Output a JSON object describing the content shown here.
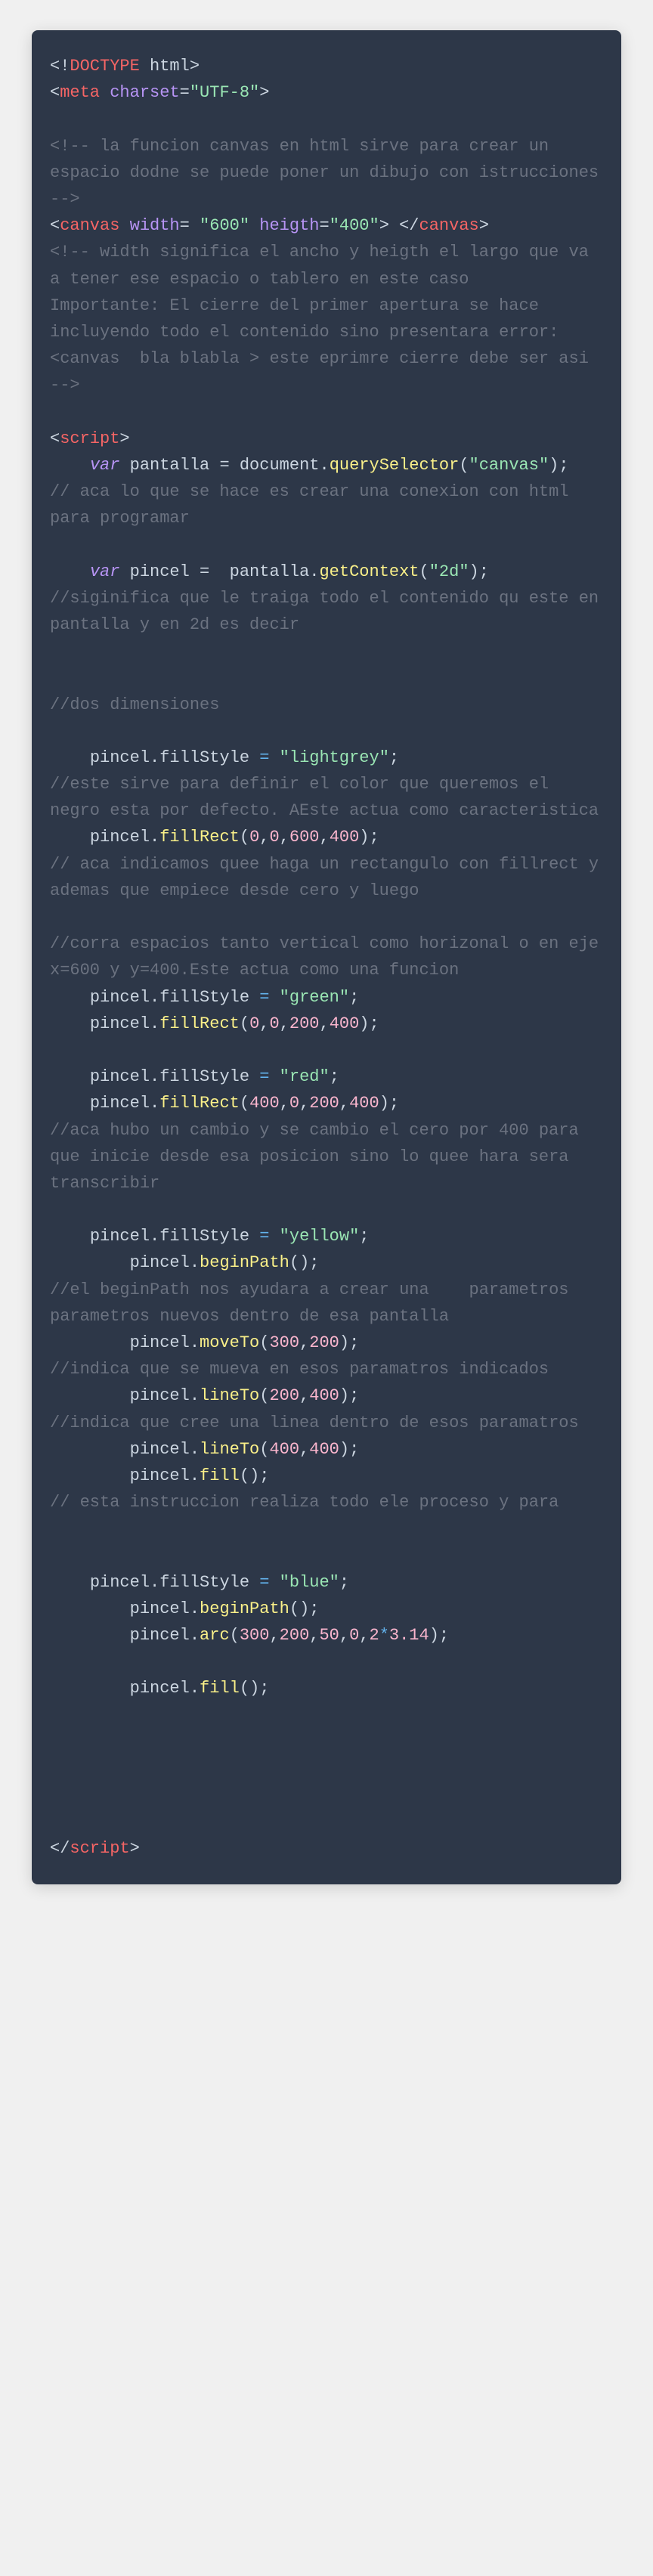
{
  "code": {
    "doctype_open": "<!",
    "doctype_word": "DOCTYPE",
    "doctype_html": " html",
    "doctype_close": ">",
    "meta_open": "<",
    "meta_tag": "meta",
    "meta_attr": "charset",
    "meta_eq": "=",
    "meta_val": "\"UTF-8\"",
    "meta_close": ">",
    "comment1": "<!-- la funcion canvas en html sirve para crear un espacio dodne se puede poner un dibujo con istrucciones  -->",
    "canvas_open": "<",
    "canvas_tag": "canvas",
    "canvas_attr_w": "width",
    "canvas_val_w": "\"600\"",
    "canvas_attr_h": "heigth",
    "canvas_val_h": "\"400\"",
    "canvas_mid": "> </",
    "canvas_close_tag": "canvas",
    "canvas_end": ">",
    "comment2": "<!-- width significa el ancho y heigth el largo que va a tener ese espacio o tablero en este caso\nImportante: El cierre del primer apertura se hace incluyendo todo el contenido sino presentara error:\n<canvas  bla blabla > este eprimre cierre debe ser asi  -->",
    "script_open": "<",
    "script_tag": "script",
    "script_close": ">",
    "kw_var": "var",
    "var_pantalla": "pantalla",
    "eq": " = ",
    "doc": "document",
    "dot": ".",
    "querySelector": "querySelector",
    "lp": "(",
    "rp": ")",
    "semi": ";",
    "str_canvas": "\"canvas\"",
    "comment3": "// aca lo que se hace es crear una conexion con html para programar",
    "var_pincel": "pincel",
    "getContext": "getContext",
    "str_2d": "\"2d\"",
    "comment4": "//siginifica que le traiga todo el contenido qu este en pantalla y en 2d es decir",
    "comment5": "//dos dimensiones",
    "fillStyle": "fillStyle",
    "str_lightgrey": "\"lightgrey\"",
    "comment6": "//este sirve para definir el color que queremos el negro esta por defecto. AEste actua como caracteristica",
    "fillRect": "fillRect",
    "n0": "0",
    "n600": "600",
    "n400": "400",
    "n200": "200",
    "n300": "300",
    "n50": "50",
    "n2": "2",
    "n314": "3.14",
    "comma": ",",
    "comment7": "// aca indicamos quee haga un rectangulo con fillrect y ademas que empiece desde cero y luego",
    "comment8": "//corra espacios tanto vertical como horizonal o en eje x=600 y y=400.Este actua como una funcion",
    "str_green": "\"green\"",
    "str_red": "\"red\"",
    "comment9": "//aca hubo un cambio y se cambio el cero por 400 para que inicie desde esa posicion sino lo quee hara sera transcribir",
    "str_yellow": "\"yellow\"",
    "beginPath": "beginPath",
    "comment10": "//el beginPath nos ayudara a crear una    parametros parametros nuevos dentro de esa pantalla",
    "moveTo": "moveTo",
    "comment11": "//indica que se mueva en esos paramatros indicados",
    "lineTo": "lineTo",
    "comment12": "//indica que cree una linea dentro de esos paramatros",
    "fill": "fill",
    "comment13": "// esta instruccion realiza todo ele proceso y para",
    "str_blue": "\"blue\"",
    "arc": "arc",
    "star": "*",
    "script_end_open": "</",
    "script_end_tag": "script",
    "script_end_close": ">"
  }
}
